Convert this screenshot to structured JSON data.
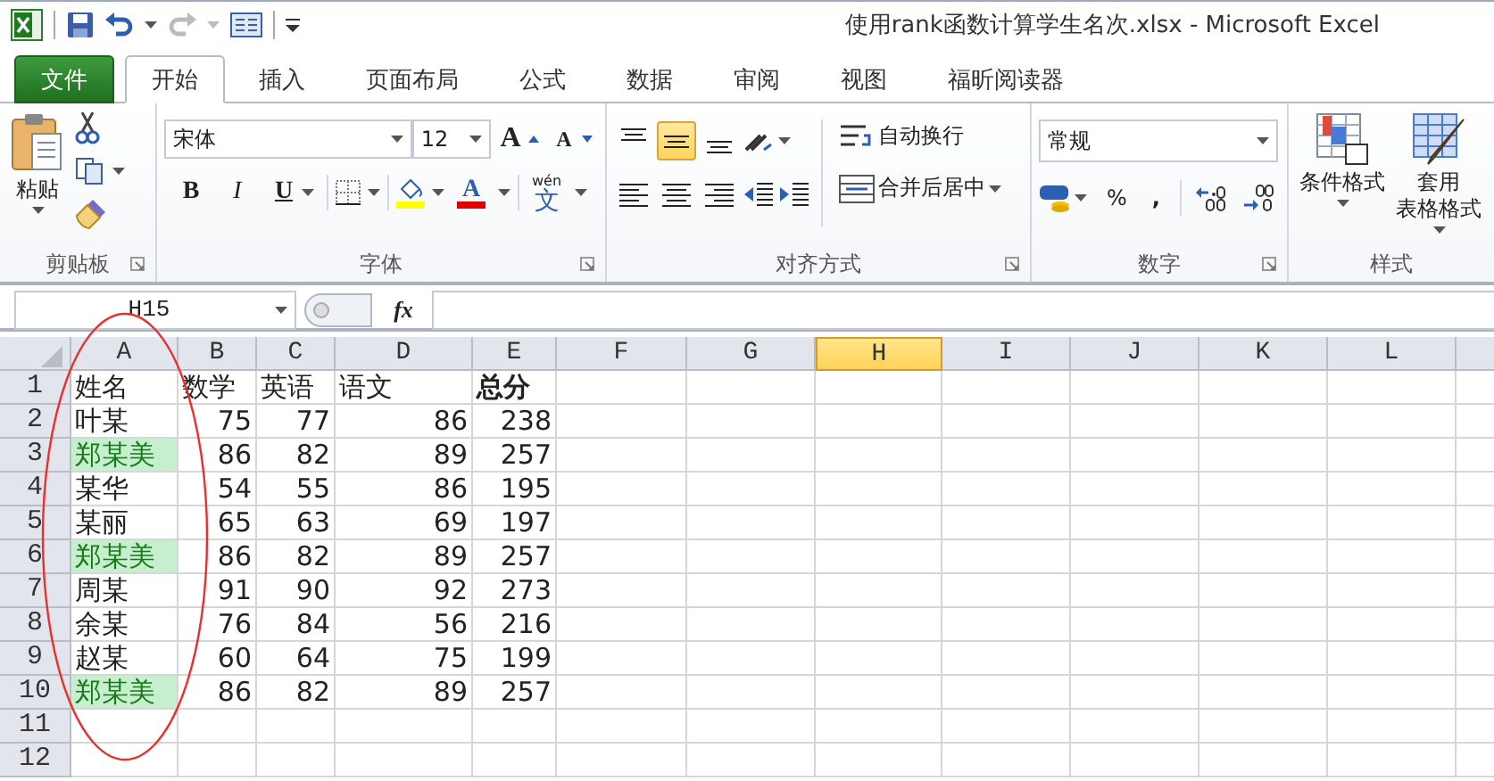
{
  "window": {
    "title": "使用rank函数计算学生名次.xlsx - Microsoft Excel"
  },
  "tabs": [
    {
      "label": "文件",
      "kind": "file",
      "selected": false
    },
    {
      "label": "开始",
      "kind": "tab",
      "selected": true
    },
    {
      "label": "插入",
      "kind": "tab",
      "selected": false
    },
    {
      "label": "页面布局",
      "kind": "tab",
      "selected": false
    },
    {
      "label": "公式",
      "kind": "tab",
      "selected": false
    },
    {
      "label": "数据",
      "kind": "tab",
      "selected": false
    },
    {
      "label": "审阅",
      "kind": "tab",
      "selected": false
    },
    {
      "label": "视图",
      "kind": "tab",
      "selected": false
    },
    {
      "label": "福昕阅读器",
      "kind": "tab",
      "selected": false
    }
  ],
  "ribbon": {
    "clipboard": {
      "label": "剪贴板",
      "paste": "粘贴"
    },
    "font": {
      "label": "字体",
      "font_name": "宋体",
      "font_size": "12",
      "grow": "A",
      "shrink": "A",
      "styles": [
        {
          "kind": "bold",
          "label": "B"
        },
        {
          "kind": "italic",
          "label": "I"
        },
        {
          "kind": "underline",
          "label": "U"
        }
      ],
      "font_color": "A",
      "phonetic": {
        "pinyin": "wén",
        "character": "文"
      }
    },
    "alignment": {
      "label": "对齐方式",
      "vertical": [
        {
          "kind": "top",
          "selected": false
        },
        {
          "kind": "middle",
          "selected": true
        },
        {
          "kind": "bottom",
          "selected": false
        }
      ],
      "horizontal": [
        {
          "kind": "left",
          "selected": false
        },
        {
          "kind": "center",
          "selected": false
        },
        {
          "kind": "right",
          "selected": false
        }
      ],
      "wrap_text": "自动换行",
      "merge": "合并后居中"
    },
    "number": {
      "label": "数字",
      "format": "常规",
      "percent": "%",
      "comma": ","
    },
    "styles": {
      "label": "样式",
      "buttons": [
        {
          "lines": [
            "条件格式"
          ]
        },
        {
          "lines": [
            "套用",
            "表格格式"
          ]
        }
      ]
    }
  },
  "formula_bar": {
    "name_box": "H15",
    "function_label": "fx"
  },
  "sheet": {
    "columns": [
      {
        "label": "A",
        "selected": false
      },
      {
        "label": "B",
        "selected": false
      },
      {
        "label": "C",
        "selected": false
      },
      {
        "label": "D",
        "selected": false
      },
      {
        "label": "E",
        "selected": false
      },
      {
        "label": "F",
        "selected": false
      },
      {
        "label": "G",
        "selected": false
      },
      {
        "label": "H",
        "selected": true
      },
      {
        "label": "I",
        "selected": false
      },
      {
        "label": "J",
        "selected": false
      },
      {
        "label": "K",
        "selected": false
      },
      {
        "label": "L",
        "selected": false
      }
    ],
    "rows": [
      {
        "number": "1",
        "kind": "header",
        "cells": [
          {
            "text": "姓名",
            "bold": false
          },
          {
            "text": "数学",
            "bold": false
          },
          {
            "text": "英语",
            "bold": false
          },
          {
            "text": "语文",
            "bold": false
          },
          {
            "text": "总分",
            "bold": true
          }
        ]
      },
      {
        "number": "2",
        "kind": "data",
        "name": "叶某",
        "highlighted": false,
        "values": [
          "75",
          "77",
          "86",
          "238"
        ]
      },
      {
        "number": "3",
        "kind": "data",
        "name": "郑某美",
        "highlighted": true,
        "values": [
          "86",
          "82",
          "89",
          "257"
        ]
      },
      {
        "number": "4",
        "kind": "data",
        "name": "某华",
        "highlighted": false,
        "values": [
          "54",
          "55",
          "86",
          "195"
        ]
      },
      {
        "number": "5",
        "kind": "data",
        "name": "某丽",
        "highlighted": false,
        "values": [
          "65",
          "63",
          "69",
          "197"
        ]
      },
      {
        "number": "6",
        "kind": "data",
        "name": "郑某美",
        "highlighted": true,
        "values": [
          "86",
          "82",
          "89",
          "257"
        ]
      },
      {
        "number": "7",
        "kind": "data",
        "name": "周某",
        "highlighted": false,
        "values": [
          "91",
          "90",
          "92",
          "273"
        ]
      },
      {
        "number": "8",
        "kind": "data",
        "name": "余某",
        "highlighted": false,
        "values": [
          "76",
          "84",
          "56",
          "216"
        ]
      },
      {
        "number": "9",
        "kind": "data",
        "name": "赵某",
        "highlighted": false,
        "values": [
          "60",
          "64",
          "75",
          "199"
        ]
      },
      {
        "number": "10",
        "kind": "data",
        "name": "郑某美",
        "highlighted": true,
        "values": [
          "86",
          "82",
          "89",
          "257"
        ]
      },
      {
        "number": "11",
        "kind": "empty"
      },
      {
        "number": "12",
        "kind": "empty"
      }
    ]
  }
}
